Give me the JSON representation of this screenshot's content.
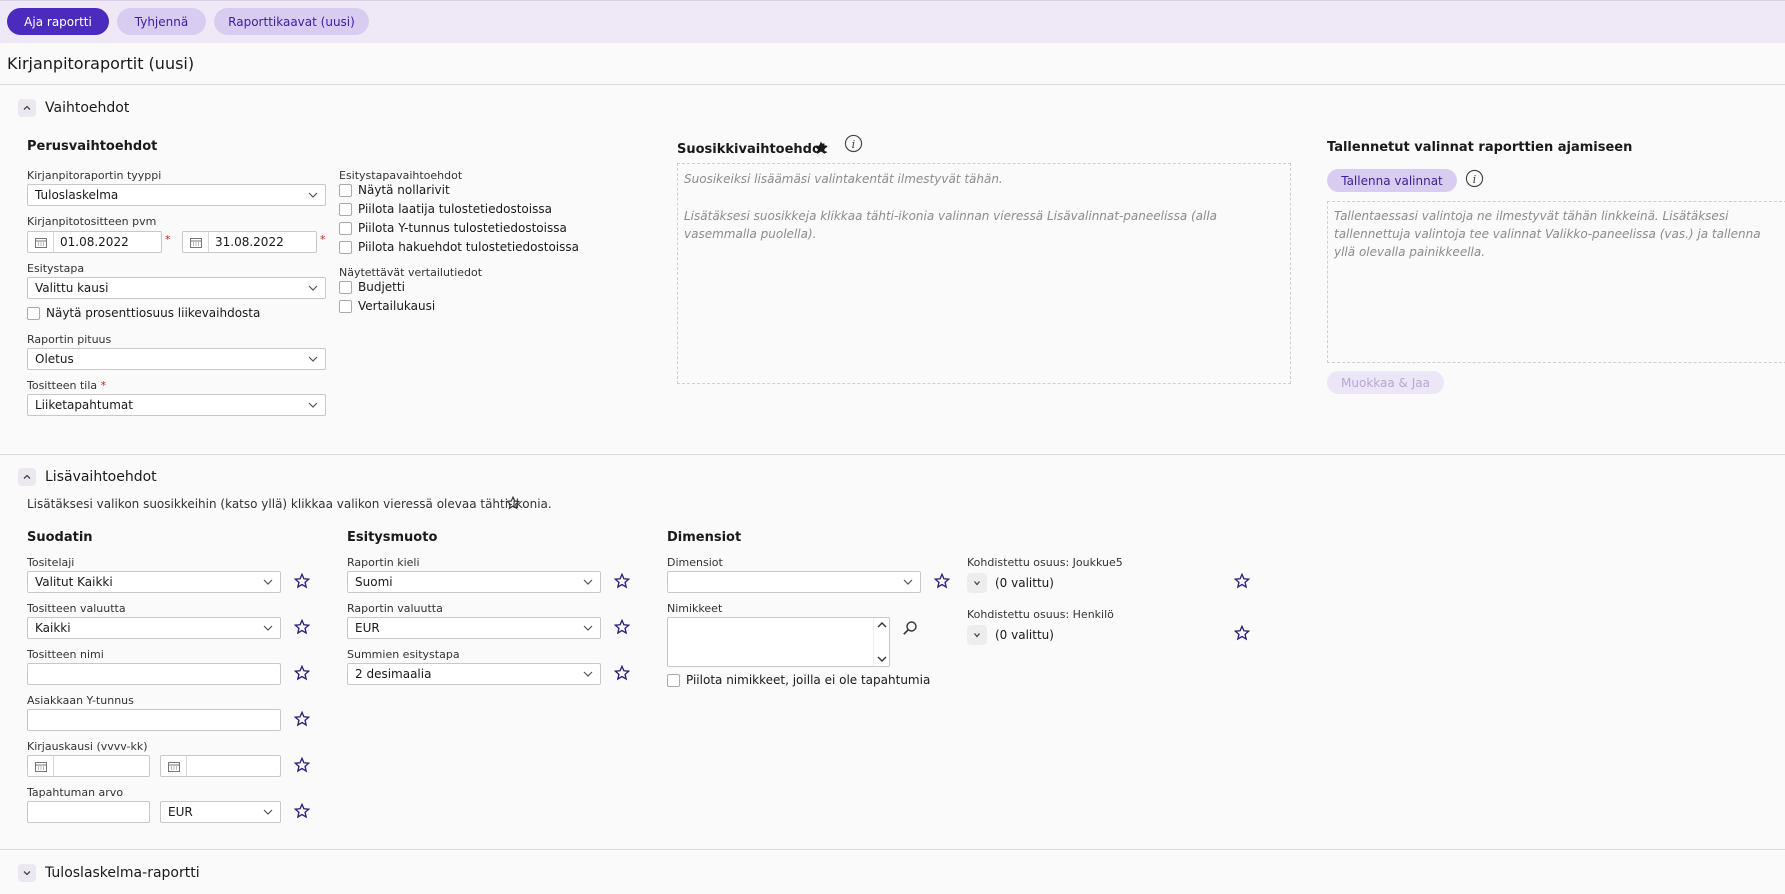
{
  "toolbar": {
    "run": "Aja raportti",
    "clear": "Tyhjennä",
    "templates": "Raporttikaavat (uusi)"
  },
  "page": {
    "title": "Kirjanpitoraportit (uusi)"
  },
  "options": {
    "title": "Vaihtoehdot",
    "basic": {
      "title": "Perusvaihtoehdot",
      "type_label": "Kirjanpitoraportin tyyppi",
      "type_value": "Tuloslaskelma",
      "date_label": "Kirjanpitotositteen pvm",
      "date_from": "01.08.2022",
      "date_to": "31.08.2022",
      "required_mark": "*",
      "presentation_label": "Esitystapa",
      "presentation_value": "Valittu kausi",
      "show_percent": "Näytä prosenttiosuus liikevaihdosta",
      "length_label": "Raportin pituus",
      "length_value": "Oletus",
      "status_label": "Tositteen tila",
      "status_value": "Liiketapahtumat"
    },
    "display": {
      "title": "Esitystapavaihtoehdot",
      "items": [
        "Näytä nollarivit",
        "Piilota laatija tulostetiedostoissa",
        "Piilota Y-tunnus tulostetiedostoissa",
        "Piilota hakuehdot tulostetiedostoissa"
      ],
      "comparison_title": "Näytettävät vertailutiedot",
      "comparison_items": [
        "Budjetti",
        "Vertailukausi"
      ]
    },
    "favorites": {
      "title": "Suosikkivaihtoehdot",
      "hint1": "Suosikeiksi lisäämäsi valintakentät ilmestyvät tähän.",
      "hint2": "Lisätäksesi suosikkeja klikkaa tähti-ikonia valinnan vieressä Lisävalinnat-paneelissa (alla vasemmalla puolella)."
    },
    "saved": {
      "title": "Tallennetut valinnat raporttien ajamiseen",
      "save_button": "Tallenna valinnat",
      "hint": "Tallentaessasi valintoja ne ilmestyvät tähän linkkeinä. Lisätäksesi tallennettuja valintoja tee valinnat Valikko-paneelissa (vas.) ja tallenna yllä olevalla painikkeella.",
      "edit_button": "Muokkaa & Jaa"
    }
  },
  "additional": {
    "title": "Lisävaihtoehdot",
    "hint": "Lisätäksesi valikon suosikkeihin (katso yllä) klikkaa valikon vieressä olevaa tähti-ikonia.",
    "filter": {
      "title": "Suodatin",
      "doc_type_label": "Tositelaji",
      "doc_type_value": "Valitut Kaikki",
      "currency_label": "Tositteen valuutta",
      "currency_value": "Kaikki",
      "doc_name_label": "Tositteen nimi",
      "customer_id_label": "Asiakkaan Y-tunnus",
      "period_label": "Kirjauskausi (vvvv-kk)",
      "amount_label": "Tapahtuman arvo",
      "amount_currency": "EUR"
    },
    "format": {
      "title": "Esitysmuoto",
      "language_label": "Raportin kieli",
      "language_value": "Suomi",
      "currency_label": "Raportin valuutta",
      "currency_value": "EUR",
      "sums_label": "Summien esitystapa",
      "sums_value": "2 desimaalia"
    },
    "dimensions": {
      "title": "Dimensiot",
      "dim_label": "Dimensiot",
      "dim_value": "",
      "items_label": "Nimikkeet",
      "hide_items": "Piilota nimikkeet, joilla ei ole tapahtumia",
      "alloc1_label": "Kohdistettu osuus: Joukkue5",
      "alloc1_value": "(0 valittu)",
      "alloc2_label": "Kohdistettu osuus: Henkilö",
      "alloc2_value": "(0 valittu)"
    }
  },
  "report_section": {
    "title": "Tuloslaskelma-raportti"
  },
  "colors": {
    "accent": "#4a2bbd",
    "accent_light": "#d8cdf0",
    "topbar": "#efe9f7",
    "star": "#2a1f7a"
  }
}
